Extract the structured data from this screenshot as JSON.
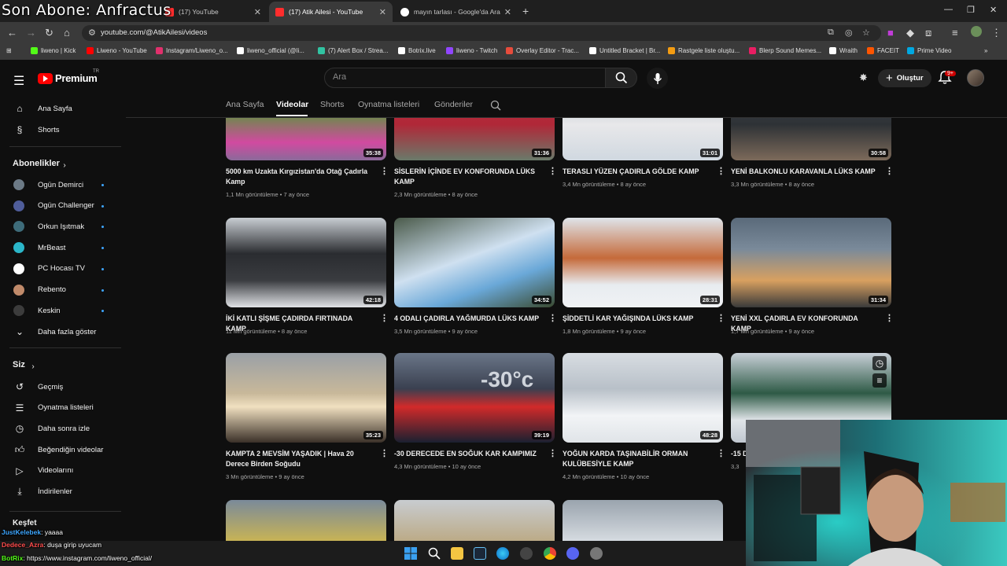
{
  "overlay": {
    "title": "Son Abone: Anfractus"
  },
  "browser": {
    "tabs": [
      {
        "label": "(17) YouTube",
        "fav": "#ff2d2d"
      },
      {
        "label": "(17) Atik Ailesi - YouTube",
        "fav": "#ff2d2d"
      },
      {
        "label": "mayın tarlası - Google'da Ara",
        "fav": "#4285f4"
      }
    ],
    "url": "youtube.com/@AtikAilesi/videos",
    "bookmarks": [
      {
        "label": "liweno | Kick",
        "color": "#53fc18"
      },
      {
        "label": "Liweno - YouTube",
        "color": "#ff0000"
      },
      {
        "label": "Instagram/Liweno_o...",
        "color": "#e1306c"
      },
      {
        "label": "liweno_official (@li...",
        "color": "#ffffff"
      },
      {
        "label": "(7) Alert Box / Strea...",
        "color": "#31c3a2"
      },
      {
        "label": "Botrix.live",
        "color": "#ffffff"
      },
      {
        "label": "liweno - Twitch",
        "color": "#9146ff"
      },
      {
        "label": "Overlay Editor - Trac...",
        "color": "#e74c3c"
      },
      {
        "label": "Untitled Bracket | Br...",
        "color": "#ffffff"
      },
      {
        "label": "Rastgele liste oluştu...",
        "color": "#f39c12"
      },
      {
        "label": "Blerp Sound Memes...",
        "color": "#e91e63"
      },
      {
        "label": "Wraith",
        "color": "#ffffff"
      },
      {
        "label": "FACEIT",
        "color": "#ff5500"
      },
      {
        "label": "Prime Video",
        "color": "#00a8e1"
      }
    ]
  },
  "header": {
    "logo": "Premium",
    "logo_suffix": "TR",
    "search_placeholder": "Ara",
    "create_label": "Oluştur",
    "notif_count": "9+"
  },
  "sidebar": {
    "main": [
      {
        "label": "Ana Sayfa",
        "icon": "home-icon"
      },
      {
        "label": "Shorts",
        "icon": "shorts-icon"
      }
    ],
    "subs_title": "Abonelikler",
    "subs": [
      {
        "label": "Ogün Demirci",
        "color": "#6c7a86"
      },
      {
        "label": "Ogün Challenger",
        "color": "#4f5d9a"
      },
      {
        "label": "Orkun Işıtmak",
        "color": "#3e6c7a"
      },
      {
        "label": "MrBeast",
        "color": "#2bb6c9"
      },
      {
        "label": "PC Hocası TV",
        "color": "#ffffff"
      },
      {
        "label": "Rebento",
        "color": "#c08a6a"
      },
      {
        "label": "Keskin",
        "color": "#3c3c3c"
      }
    ],
    "show_more": "Daha fazla göster",
    "you_title": "Siz",
    "you": [
      {
        "label": "Geçmiş",
        "icon": "history-icon"
      },
      {
        "label": "Oynatma listeleri",
        "icon": "playlists-icon"
      },
      {
        "label": "Daha sonra izle",
        "icon": "watch-later-icon"
      },
      {
        "label": "Beğendiğin videolar",
        "icon": "liked-icon"
      },
      {
        "label": "Videolarını",
        "icon": "your-videos-icon"
      },
      {
        "label": "İndirilenler",
        "icon": "downloads-icon"
      }
    ],
    "explore_title": "Keşfet"
  },
  "channel_tabs": [
    "Ana Sayfa",
    "Videolar",
    "Shorts",
    "Oynatma listeleri",
    "Gönderiler"
  ],
  "videos": [
    {
      "title": "5000 km Uzakta Kırgızistan'da Otağ Çadırla Kamp",
      "views": "1,1 Mn görüntüleme",
      "ago": "7 ay önce",
      "duration": "35:38"
    },
    {
      "title": "SİSLERİN İÇİNDE EV KONFORUNDA LÜKS KAMP",
      "views": "2,3 Mn görüntüleme",
      "ago": "8 ay önce",
      "duration": "31:36"
    },
    {
      "title": "TERASLI YÜZEN ÇADIRLA GÖLDE KAMP",
      "views": "3,4 Mn görüntüleme",
      "ago": "8 ay önce",
      "duration": "31:01"
    },
    {
      "title": "YENİ BALKONLU KARAVANLA LÜKS KAMP",
      "views": "3,3 Mn görüntüleme",
      "ago": "8 ay önce",
      "duration": "30:58"
    },
    {
      "title": "İKİ KATLI ŞİŞME ÇADIRDA FIRTINADA KAMP",
      "views": "11 Mn görüntüleme",
      "ago": "8 ay önce",
      "duration": "42:18"
    },
    {
      "title": "4 ODALI ÇADIRLA YAĞMURDA LÜKS KAMP",
      "views": "3,5 Mn görüntüleme",
      "ago": "9 ay önce",
      "duration": "34:52"
    },
    {
      "title": "ŞİDDETLİ KAR YAĞIŞINDA LÜKS KAMP",
      "views": "1,8 Mn görüntüleme",
      "ago": "9 ay önce",
      "duration": "28:31"
    },
    {
      "title": "YENİ XXL ÇADIRLA EV KONFORUNDA KAMP",
      "views": "1,7 Mn görüntüleme",
      "ago": "9 ay önce",
      "duration": "31:34"
    },
    {
      "title": "KAMPTA 2 MEVSİM YAŞADIK | Hava 20 Derece Birden Soğudu",
      "views": "3 Mn görüntüleme",
      "ago": "9 ay önce",
      "duration": "35:23"
    },
    {
      "title": "-30 DERECEDE EN SOĞUK KAR KAMPIMIZ",
      "views": "4,3 Mn görüntüleme",
      "ago": "10 ay önce",
      "duration": "39:19"
    },
    {
      "title": "YOĞUN KARDA TAŞINABİLİR ORMAN KULÜBESİYLE KAMP",
      "views": "4,2 Mn görüntüleme",
      "ago": "10 ay önce",
      "duration": "48:28"
    },
    {
      "title": "-15 D",
      "views": "3,3",
      "ago": "",
      "duration": ""
    }
  ],
  "thumb_overlay_text": "-30°c",
  "chat": [
    {
      "user": "JustKelebek",
      "msg": ": yaaaa",
      "color": "#3ea6ff"
    },
    {
      "user": "Dedece_Azra",
      "msg": ": duşa girip uyucam",
      "color": "#ff4d4d"
    },
    {
      "user": "BotRix",
      "msg": ": https://www.instagram.com/liweno_official/",
      "color": "#53fc18"
    }
  ]
}
